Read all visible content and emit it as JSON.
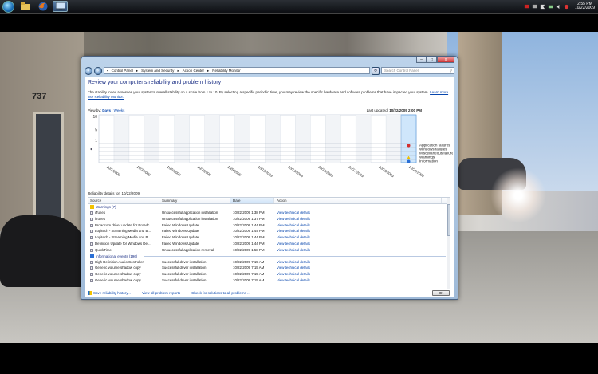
{
  "taskbar": {
    "clock_time": "2:55 PM",
    "clock_date": "10/22/2009",
    "pinned": [
      "windows-explorer-icon",
      "firefox-icon",
      "control-panel-icon"
    ]
  },
  "window": {
    "address_parts": [
      "Control Panel",
      "System and Security",
      "Action Center",
      "Reliability Monitor"
    ],
    "search_placeholder": "Search Control Panel",
    "controls": {
      "minimize": "–",
      "maximize": "□",
      "close": "x"
    }
  },
  "page": {
    "title": "Review your computer's reliability and problem history",
    "description": "The stability index assesses your system's overall stability on a scale from 1 to 10. By selecting a specific period in time, you may review the specific hardware and software problems that have impacted your system.",
    "learn_more": "Learn more",
    "learn_more_tail": "use Reliability Monitor.",
    "view_by_label": "View by:",
    "view_days": "Days",
    "view_separator": "|",
    "view_weeks": "Weeks",
    "last_updated_label": "Last updated:",
    "last_updated_value": "10/22/2009 2:00 PM",
    "details_header": "Reliability details for: 10/22/2009"
  },
  "chart_data": {
    "type": "line",
    "title": "",
    "y_ticks": [
      "10",
      "5",
      "1"
    ],
    "ylim": [
      1,
      10
    ],
    "x_dates": [
      "10/1/2009",
      "10/3/2009",
      "10/5/2009",
      "10/7/2009",
      "10/9/2009",
      "10/11/2009",
      "10/13/2009",
      "10/15/2009",
      "10/17/2009",
      "10/19/2009",
      "10/21/2009"
    ],
    "category_labels": [
      "Application failures",
      "Windows failures",
      "Miscellaneous failures",
      "Warnings",
      "Information"
    ],
    "selected_date": "10/22/2009",
    "grid": true
  },
  "table": {
    "columns": [
      "Source",
      "Summary",
      "Date",
      "Action"
    ],
    "groups": [
      {
        "label": "Warnings (7)",
        "rows": [
          [
            "iTunes",
            "Unsuccessful application installation",
            "10/22/2009 1:38 PM",
            "View technical details"
          ],
          [
            "iTunes",
            "Unsuccessful application installation",
            "10/22/2009 1:37 PM",
            "View technical details"
          ],
          [
            "Broadcom driver update for Broadc...",
            "Failed Windows Update",
            "10/22/2009 1:44 PM",
            "View technical details"
          ],
          [
            "Logitech - Streaming Media and B...",
            "Failed Windows Update",
            "10/22/2009 1:44 PM",
            "View technical details"
          ],
          [
            "Logitech - Streaming Media and B...",
            "Failed Windows Update",
            "10/22/2009 1:44 PM",
            "View technical details"
          ],
          [
            "Definition Update for Windows De...",
            "Failed Windows Update",
            "10/22/2009 1:44 PM",
            "View technical details"
          ],
          [
            "QuickTime",
            "Unsuccessful application removal",
            "10/22/2009 1:58 PM",
            "View technical details"
          ]
        ]
      },
      {
        "label": "Informational events (196)",
        "rows": [
          [
            "High Definition Audio Controller",
            "Successful driver installation",
            "10/22/2009 7:15 AM",
            "View technical details"
          ],
          [
            "Generic volume shadow copy",
            "Successful driver installation",
            "10/22/2009 7:15 AM",
            "View technical details"
          ],
          [
            "Generic volume shadow copy",
            "Successful driver installation",
            "10/22/2009 7:15 AM",
            "View technical details"
          ],
          [
            "Generic volume shadow copy",
            "Successful driver installation",
            "10/22/2009 7:15 AM",
            "View technical details"
          ]
        ]
      }
    ]
  },
  "footer": {
    "save_history": "Save reliability history...",
    "all_reports": "View all problem reports",
    "check_solutions": "Check for solutions to all problems ...",
    "ok": "OK"
  },
  "colors": {
    "accent": "#1e3287",
    "link": "#0645ad",
    "error": "#d32f2f",
    "warning": "#f2c200",
    "info": "#2a6fd6"
  }
}
